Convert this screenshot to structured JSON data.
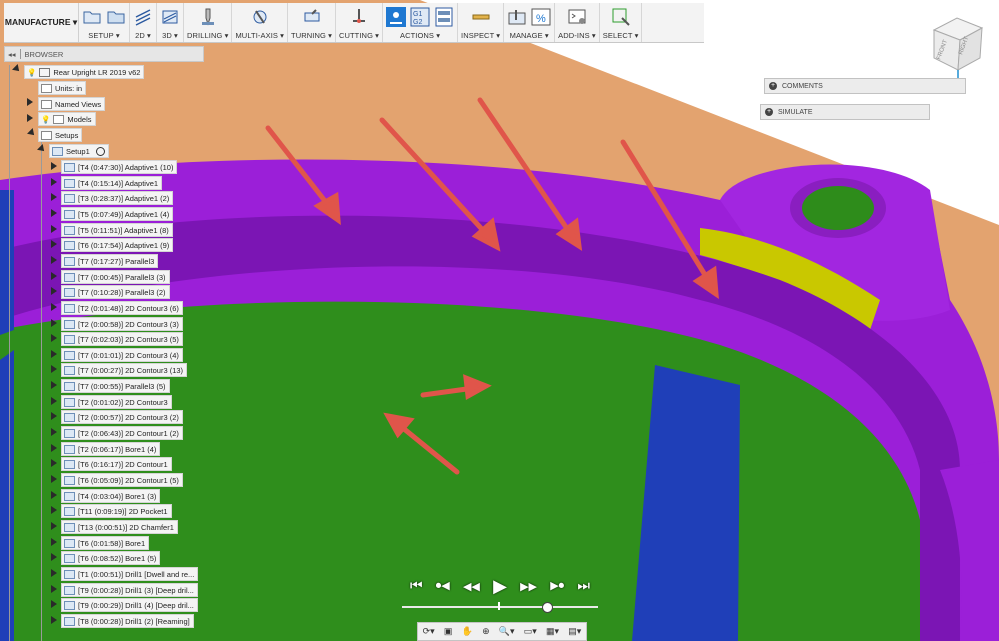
{
  "toolbar": {
    "workspace": "MANUFACTURE ▾",
    "groups": [
      {
        "label": "SETUP ▾",
        "icons": [
          "folder-open-icon",
          "folder-icon"
        ]
      },
      {
        "label": "2D ▾",
        "icons": [
          "2d-toolpath-icon"
        ]
      },
      {
        "label": "3D ▾",
        "icons": [
          "3d-toolpath-icon"
        ]
      },
      {
        "label": "DRILLING ▾",
        "icons": [
          "drill-icon"
        ]
      },
      {
        "label": "MULTI-AXIS ▾",
        "icons": [
          "multi-axis-icon"
        ]
      },
      {
        "label": "TURNING ▾",
        "icons": [
          "turning-icon"
        ]
      },
      {
        "label": "CUTTING ▾",
        "icons": [
          "cutting-icon"
        ]
      },
      {
        "label": "ACTIONS ▾",
        "icons": [
          "simulate-icon",
          "gcode-icon",
          "setup-sheet-icon"
        ]
      },
      {
        "label": "INSPECT ▾",
        "icons": [
          "measure-icon"
        ]
      },
      {
        "label": "MANAGE ▾",
        "icons": [
          "tool-library-icon",
          "post-library-icon"
        ]
      },
      {
        "label": "ADD-INS ▾",
        "icons": [
          "scripts-icon"
        ]
      },
      {
        "label": "SELECT ▾",
        "icons": [
          "select-icon"
        ]
      }
    ],
    "g1g2_text": "G1 G2",
    "percent_text": "%"
  },
  "browser": {
    "title": "BROWSER",
    "root": "Rear Upright LR 2019 v62",
    "units": "Units: in",
    "named_views": "Named Views",
    "models": "Models",
    "setups": "Setups",
    "setup1": "Setup1",
    "operations": [
      "[T4 (0:47:30)] Adaptive1 (10)",
      "[T4 (0:15:14)] Adaptive1",
      "[T3 (0:28:37)] Adaptive1 (2)",
      "[T5 (0:07:49)] Adaptive1 (4)",
      "[T5 (0:11:51)] Adaptive1 (8)",
      "[T6 (0:17:54)] Adaptive1 (9)",
      "[T7 (0:17:27)] Parallel3",
      "[T7 (0:00:45)] Parallel3 (3)",
      "[T7 (0:10:28)] Parallel3 (2)",
      "[T2 (0:01:48)] 2D Contour3 (6)",
      "[T2 (0:00:58)] 2D Contour3 (3)",
      "[T7 (0:02:03)] 2D Contour3 (5)",
      "[T7 (0:01:01)] 2D Contour3 (4)",
      "[T7 (0:00:27)] 2D Contour3 (13)",
      "[T7 (0:00:55)] Parallel3 (5)",
      "[T2 (0:01:02)] 2D Contour3",
      "[T2 (0:00:57)] 2D Contour3 (2)",
      "[T2 (0:06:43)] 2D Contour1 (2)",
      "[T2 (0:06:17)] Bore1 (4)",
      "[T6 (0:16:17)] 2D Contour1",
      "[T6 (0:05:09)] 2D Contour1 (5)",
      "[T4 (0:03:04)] Bore1 (3)",
      "[T11 (0:09:19)] 2D Pocket1",
      "[T13 (0:00:51)] 2D Chamfer1",
      "[T6 (0:01:58)] Bore1",
      "[T6 (0:08:52)] Bore1 (5)",
      "[T1 (0:00:51)] Drill1 [Dwell and re...",
      "[T9 (0:00:28)] Drill1 (3) [Deep dril...",
      "[T9 (0:00:29)] Drill1 (4) [Deep dril...",
      "[T8 (0:00:28)] Drill1 (2) [Reaming]"
    ]
  },
  "panels": {
    "comments": "COMMENTS",
    "simulate": "SIMULATE"
  },
  "viewcube": {
    "front": "FRONT",
    "right": "RIGHT"
  },
  "playback": {
    "buttons": [
      "⏮",
      "⏺◀",
      "◀◀",
      "▶",
      "▶▶",
      "▶⏺",
      "⏭"
    ]
  },
  "navbar": {
    "icons": [
      "orbit-icon",
      "look-at-icon",
      "pan-icon",
      "zoom-icon",
      "fit-icon",
      "display-icon",
      "grid-icon",
      "viewports-icon"
    ]
  },
  "colors": {
    "background": "#e3a36f",
    "purple": "#9a1fd6",
    "purple_dark": "#7a14b2",
    "green": "#2e8c1b",
    "blue": "#1f3fb8",
    "yellow": "#c8c800",
    "arrow": "#e0554a"
  }
}
